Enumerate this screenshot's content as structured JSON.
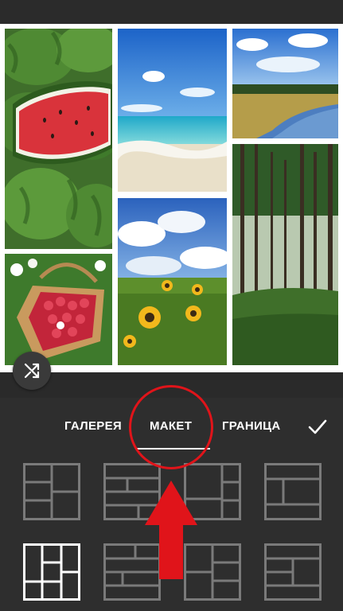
{
  "tabs": {
    "gallery": "ГАЛЕРЕЯ",
    "layout": "МАКЕТ",
    "border": "ГРАНИЦА"
  },
  "active_tab": "layout",
  "photos": [
    "watermelons",
    "beach",
    "river",
    "raspberries",
    "sunflowers",
    "forest"
  ],
  "selected_layout_index": 4,
  "colors": {
    "panel_bg": "#2e2e2e",
    "tile_stroke": "#7a7a7a",
    "tile_selected": "#ffffff",
    "annotation": "#e0141a"
  },
  "icons": {
    "shuffle": "shuffle-icon",
    "confirm": "check-icon"
  }
}
